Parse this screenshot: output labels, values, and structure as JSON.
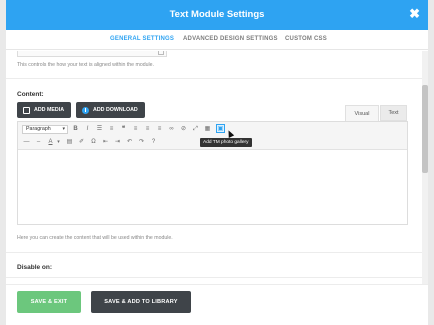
{
  "header": {
    "title": "Text Module Settings",
    "close": "✖"
  },
  "tabs": [
    {
      "label": "GENERAL SETTINGS",
      "active": true
    },
    {
      "label": "ADVANCED DESIGN SETTINGS",
      "active": false
    },
    {
      "label": "CUSTOM CSS",
      "active": false
    }
  ],
  "prev_help": "This controls the how your text is aligned within the module.",
  "content": {
    "label": "Content:",
    "add_media": "ADD MEDIA",
    "add_download": "ADD DOWNLOAD",
    "visual_tab": "Visual",
    "text_tab": "Text",
    "format_select": "Paragraph",
    "tooltip": "Add TM photo gallery",
    "help": "Here you can create the content that will be used within the module."
  },
  "disable_label": "Disable on:",
  "footer": {
    "save": "SAVE & EXIT",
    "save_library": "SAVE & ADD TO LIBRARY"
  },
  "colors": {
    "accent": "#2ea3f2",
    "save": "#6cc77d",
    "dark": "#3f4449"
  }
}
